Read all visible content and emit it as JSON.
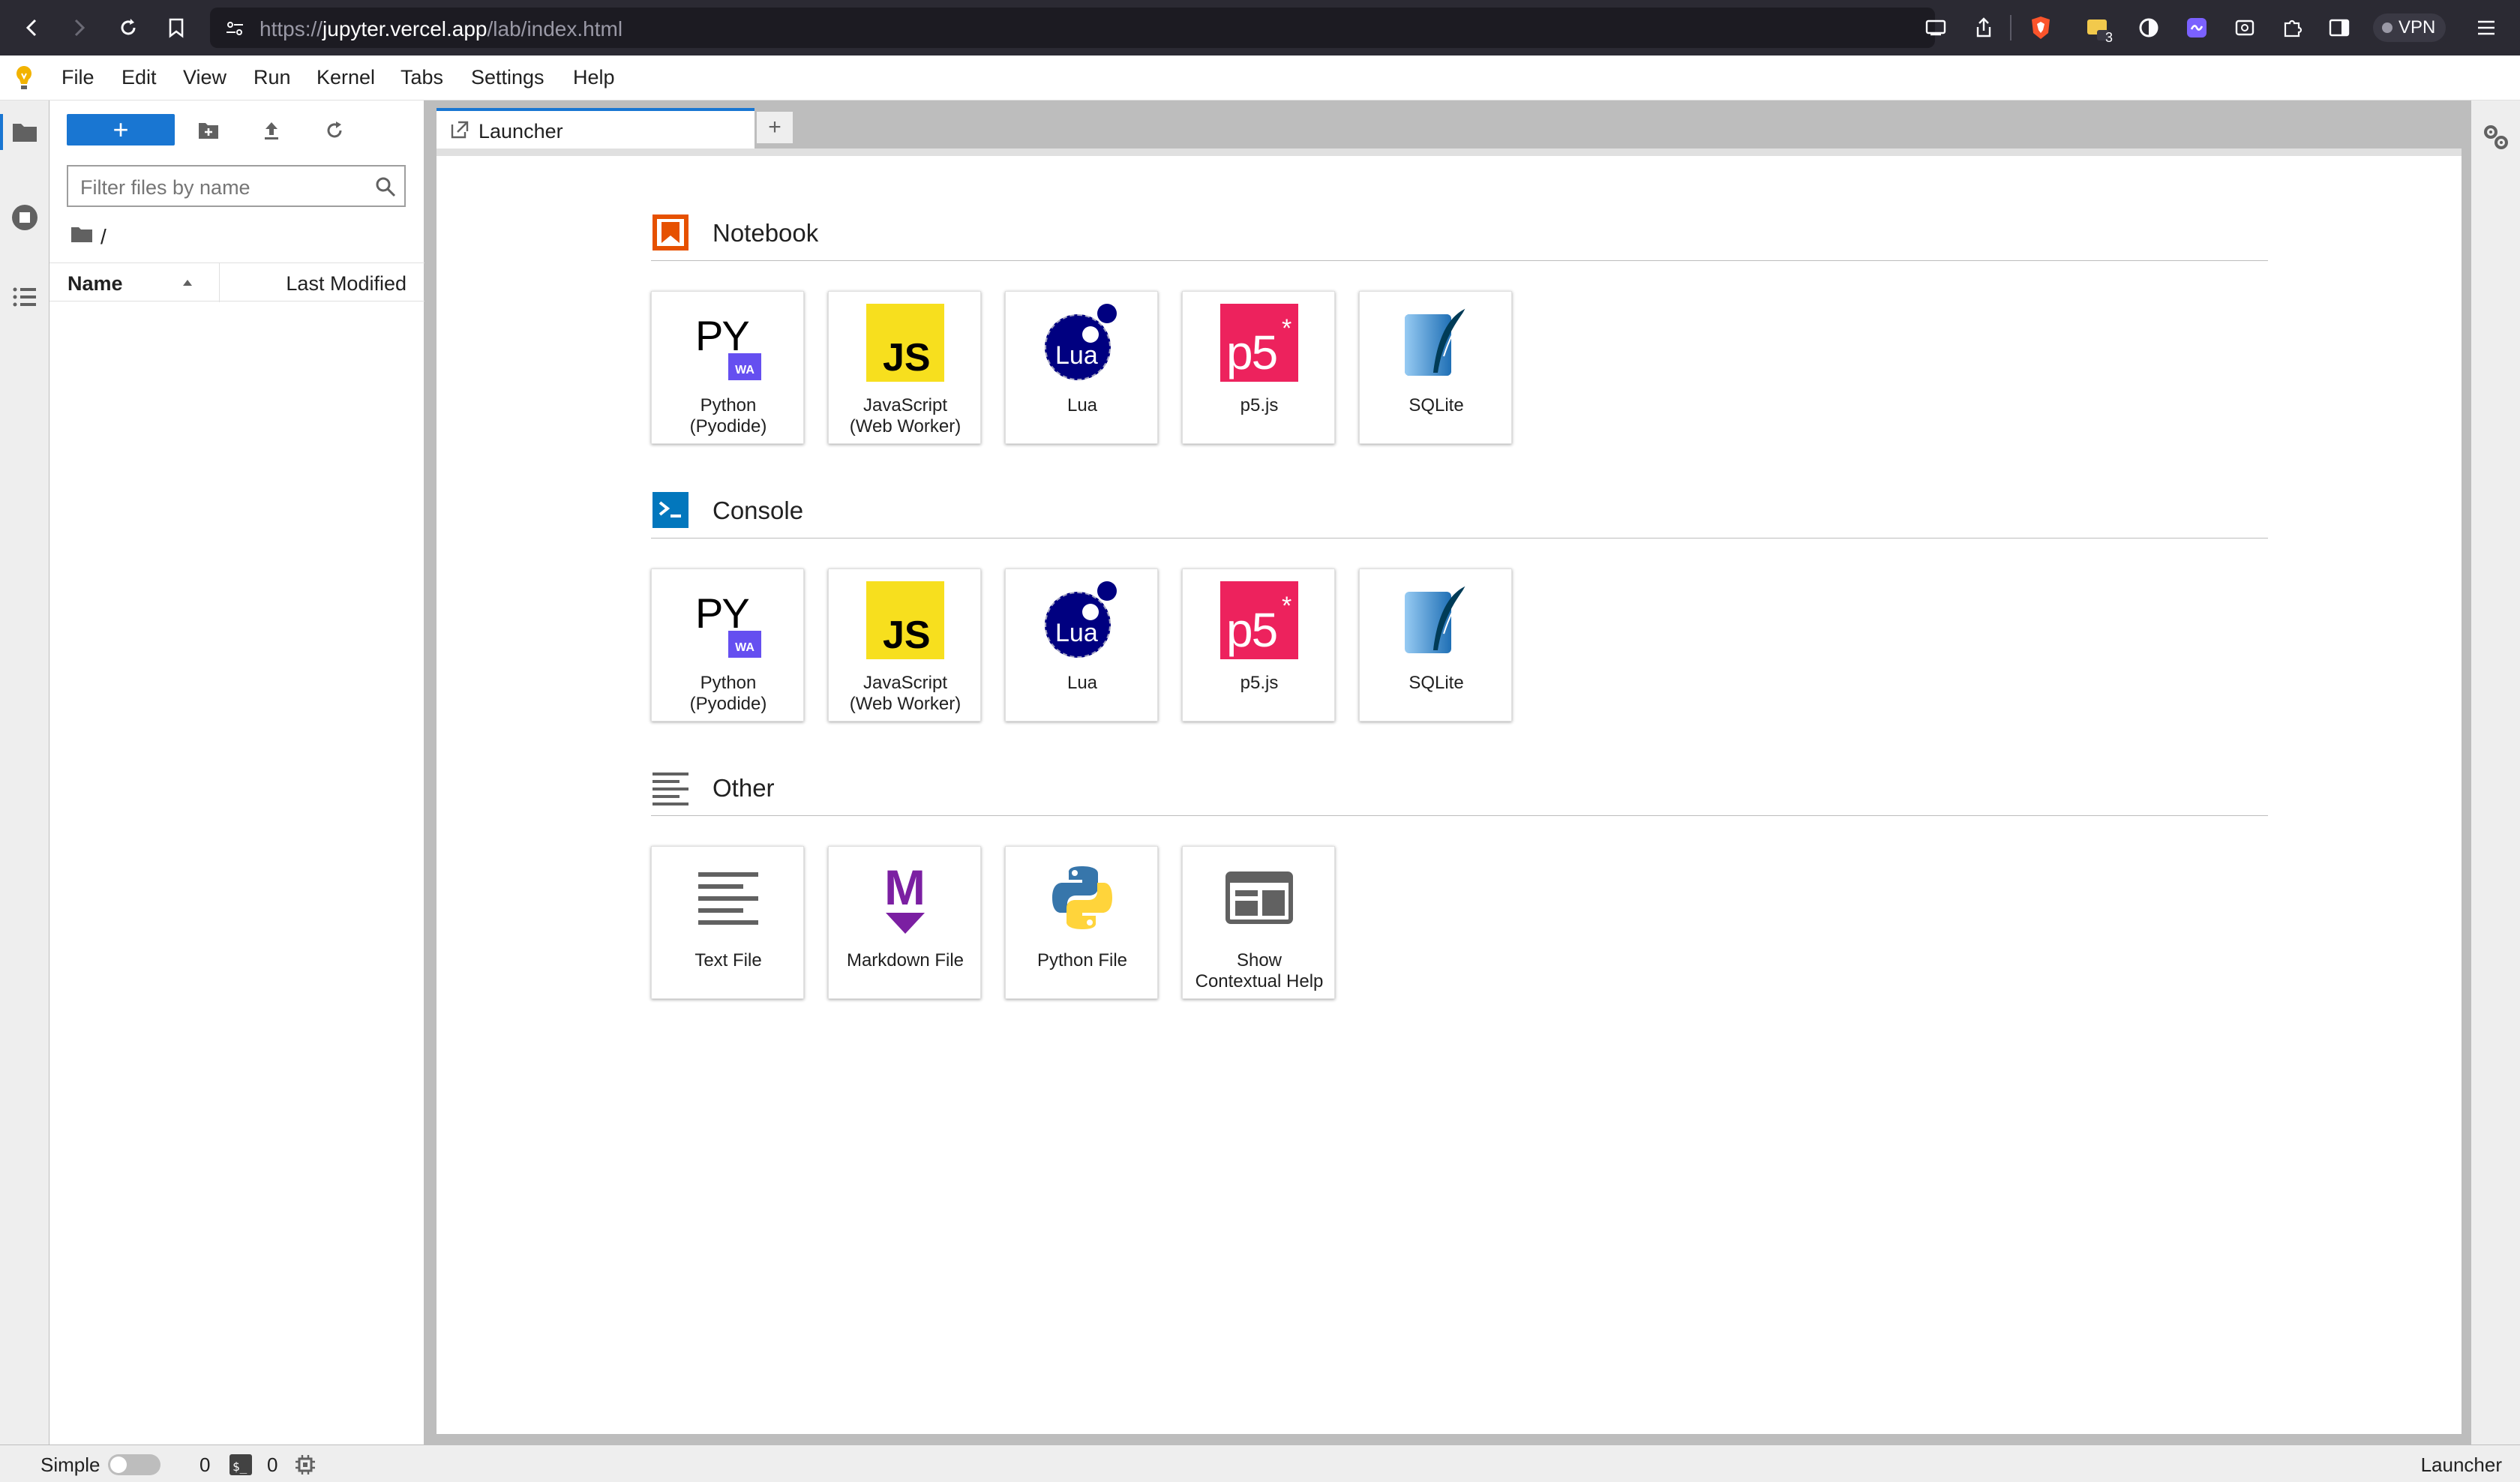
{
  "browser": {
    "url_prefix": "https://",
    "url_host": "jupyter.vercel.app",
    "url_path": "/lab/index.html",
    "extension_badge": "3",
    "vpn_label": "VPN"
  },
  "menu": {
    "items": [
      "File",
      "Edit",
      "View",
      "Run",
      "Kernel",
      "Tabs",
      "Settings",
      "Help"
    ]
  },
  "filebrowser": {
    "new_label": "+",
    "filter_placeholder": "Filter files by name",
    "breadcrumb": "/",
    "col_name": "Name",
    "col_modified": "Last Modified"
  },
  "tabs": {
    "active_label": "Launcher",
    "add_label": "+"
  },
  "launcher": {
    "sections": [
      {
        "title": "Notebook",
        "icon": "notebook-icon",
        "cards": [
          {
            "label1": "Python",
            "label2": "(Pyodide)",
            "icon": "python-pyodide-logo"
          },
          {
            "label1": "JavaScript",
            "label2": "(Web Worker)",
            "icon": "javascript-logo"
          },
          {
            "label1": "Lua",
            "label2": "",
            "icon": "lua-logo"
          },
          {
            "label1": "p5.js",
            "label2": "",
            "icon": "p5js-logo"
          },
          {
            "label1": "SQLite",
            "label2": "",
            "icon": "sqlite-logo"
          }
        ]
      },
      {
        "title": "Console",
        "icon": "console-icon",
        "cards": [
          {
            "label1": "Python",
            "label2": "(Pyodide)",
            "icon": "python-pyodide-logo"
          },
          {
            "label1": "JavaScript",
            "label2": "(Web Worker)",
            "icon": "javascript-logo"
          },
          {
            "label1": "Lua",
            "label2": "",
            "icon": "lua-logo"
          },
          {
            "label1": "p5.js",
            "label2": "",
            "icon": "p5js-logo"
          },
          {
            "label1": "SQLite",
            "label2": "",
            "icon": "sqlite-logo"
          }
        ]
      },
      {
        "title": "Other",
        "icon": "other-icon",
        "cards": [
          {
            "label1": "Text File",
            "label2": "",
            "icon": "text-file-icon"
          },
          {
            "label1": "Markdown File",
            "label2": "",
            "icon": "markdown-icon"
          },
          {
            "label1": "Python File",
            "label2": "",
            "icon": "python-logo"
          },
          {
            "label1": "Show",
            "label2": "Contextual Help",
            "icon": "contextual-help-icon"
          }
        ]
      }
    ],
    "logo_text": {
      "py": "PY",
      "wa": "WA",
      "js": "JS",
      "lua": "Lua",
      "p5": "p5",
      "p5_star": "*",
      "md": "M"
    }
  },
  "statusbar": {
    "mode_label": "Simple",
    "kernels_count": "0",
    "terminals_count": "0",
    "right_label": "Launcher"
  },
  "colors": {
    "accent": "#1976d2",
    "notebook_icon": "#e65100",
    "js_yellow": "#f7df1e",
    "lua_navy": "#000080",
    "p5_pink": "#ed225d",
    "markdown_purple": "#7b1fa2"
  }
}
